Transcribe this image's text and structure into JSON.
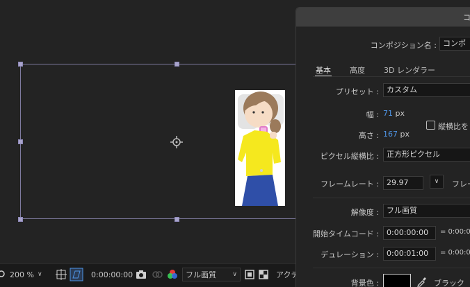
{
  "toolbar": {
    "zoom": "200 %",
    "timecode": "0:00:00:00",
    "resolution": "フル画質",
    "active_camera": "アクテ"
  },
  "dialog": {
    "title": "コン",
    "comp_name_label": "コンポジション名 :",
    "comp_name_value": "コンポ",
    "tabs": [
      "基本",
      "高度",
      "3D レンダラー"
    ],
    "preset_label": "プリセット :",
    "preset_value": "カスタム",
    "width_label": "幅 :",
    "width_value": "71",
    "height_label": "高さ :",
    "height_value": "167",
    "unit_px": "px",
    "lock_aspect_label": "縦横比を",
    "pixel_aspect_label": "ピクセル縦横比 :",
    "pixel_aspect_value": "正方形ピクセル",
    "frame_rate_label": "フレームレート :",
    "frame_rate_value": "29.97",
    "frame_rate_unit": "フレー",
    "resolution_label": "解像度 :",
    "resolution_value": "フル画質",
    "start_timecode_label": "開始タイムコード :",
    "start_timecode_value": "0:00:00:00",
    "start_timecode_equals": "= 0:00:00",
    "duration_label": "デュレーション :",
    "duration_value": "0:00:01:00",
    "duration_equals": "= 0:00:01",
    "bg_color_label": "背景色 :",
    "bg_color_name": "ブラック",
    "bg_color": "#000000"
  },
  "colors": {
    "accent_blue": "#4f95e6",
    "comp_frame": "#7f7ba0"
  }
}
